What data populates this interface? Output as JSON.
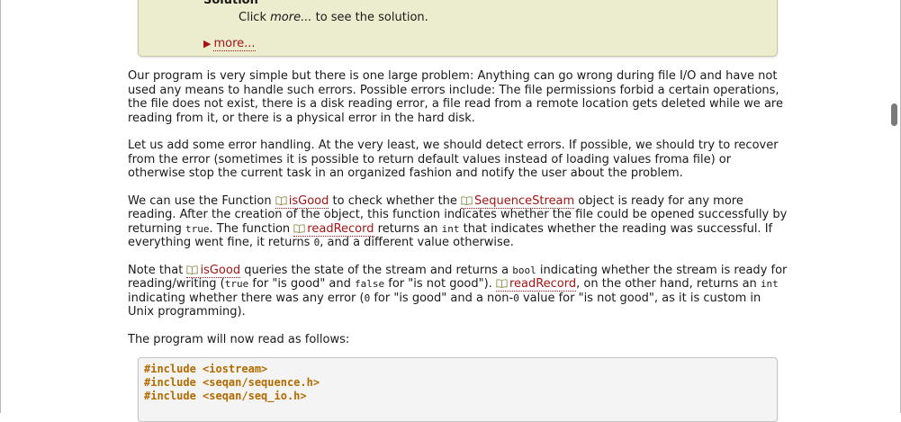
{
  "solution": {
    "title": "Solution",
    "hint_prefix": "Click ",
    "hint_em": "more...",
    "hint_suffix": " to see the solution.",
    "more_label": "more..."
  },
  "p1": {
    "text": "Our program is very simple but there is one large problem: Anything can go wrong during file I/O and have not used any means to handle such errors. Possible errors include: The file permissions forbid a certain operations, the file does not exist, there is a disk reading error, a file read from a remote location gets deleted while we are reading from it, or there is a physical error in the hard disk."
  },
  "p2": {
    "text": "Let us add some error handling. At the very least, we should detect errors. If possible, we should try to recover from the error (sometimes it is possible to return default values instead of loading values froma file) or otherwise stop the current task in an organized fashion and notify the user about the problem."
  },
  "p3": {
    "t1": "We can use the Function ",
    "ref_isgood": "isGood",
    "t2": " to check whether the ",
    "ref_seqstream": "SequenceStream",
    "t3": " object is ready for any more reading. After the creation of the object, this function indicates whether the file could be opened successfully by returning ",
    "c_true": "true",
    "t4": ". The function ",
    "ref_readrecord": "readRecord",
    "t5": " returns an ",
    "c_int": "int",
    "t6": " that indicates whether the reading was successful. If everything went fine, it returns ",
    "c_zero": "0",
    "t7": ", and a different value otherwise."
  },
  "p4": {
    "t1": "Note that ",
    "ref_isgood": "isGood",
    "t2": " queries the state of the stream and returns a ",
    "c_bool": "bool",
    "t3": " indicating whether the stream is ready for reading/writing (",
    "c_true": "true",
    "t4": " for \"is good\" and ",
    "c_false": "false",
    "t5": " for \"is not good\"). ",
    "ref_readrecord": "readRecord",
    "t6": ", on the other hand, returns an ",
    "c_int": "int",
    "t7": " indicating whether there was any error (",
    "c_zero": "0",
    "t8": " for \"is good\" and a non-",
    "c_zero2": "0",
    "t9": " value for \"is not good\", as it is custom in Unix programming)."
  },
  "p5": {
    "text": "The program will now read as follows:"
  },
  "code": {
    "line1": "#include <iostream>",
    "line2": "#include <seqan/sequence.h>",
    "line3": "#include <seqan/seq_io.h>"
  },
  "icons": {
    "ref_icon": "book-icon",
    "more_icon": "triangle-right-icon"
  },
  "colors": {
    "link": "#a31515",
    "code_text": "#b36b00",
    "solution_bg": "#ececcf"
  }
}
